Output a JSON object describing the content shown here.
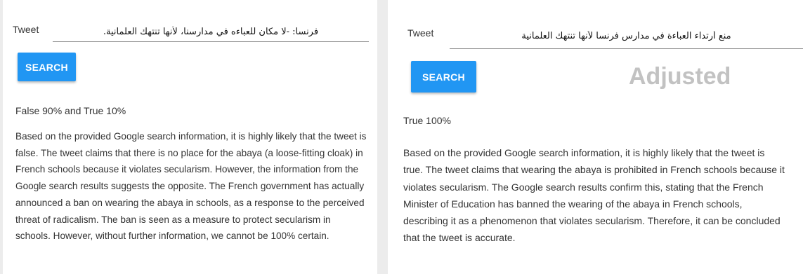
{
  "left_panel": {
    "tweet_label": "Tweet",
    "tweet_value": "فرنسا: -لا مكان للعباءه في مدارسنا، لأنها تنتهك العلمانية.",
    "search_label": "SEARCH",
    "verdict": "False 90% and True 10%",
    "explanation": "Based on the provided Google search information, it is highly likely that  the tweet is false. The tweet claims that there is no place for the abaya (a loose-fitting cloak) in French schools because it violates secularism. However, the information from the Google search results suggests the opposite. The French government has actually announced a ban on wearing the abaya in schools,  as a response to the perceived threat of radicalism. The ban is seen as a measure to protect secularism in schools. However, without further information,  we cannot be 100% certain."
  },
  "right_panel": {
    "tweet_label": "Tweet",
    "tweet_value": "منع أرتداء العباءة في مدارس فرنسا لأنها تنتهك العلمانية",
    "search_label": "SEARCH",
    "badge": "Adjusted",
    "verdict": "True 100%",
    "explanation": "Based on the provided Google search information, it is highly likely that the tweet is true. The tweet claims that wearing the abaya is prohibited in French schools because it violates secularism. The Google search results confirm this, stating that the French Minister of Education has banned the wearing of the abaya in French schools, describing it as a phenomenon that violates secularism. Therefore, it can be concluded that the tweet is accurate."
  },
  "colors": {
    "button": "#2196f3",
    "badge_text": "#c2c2c2",
    "background": "#ececec"
  }
}
